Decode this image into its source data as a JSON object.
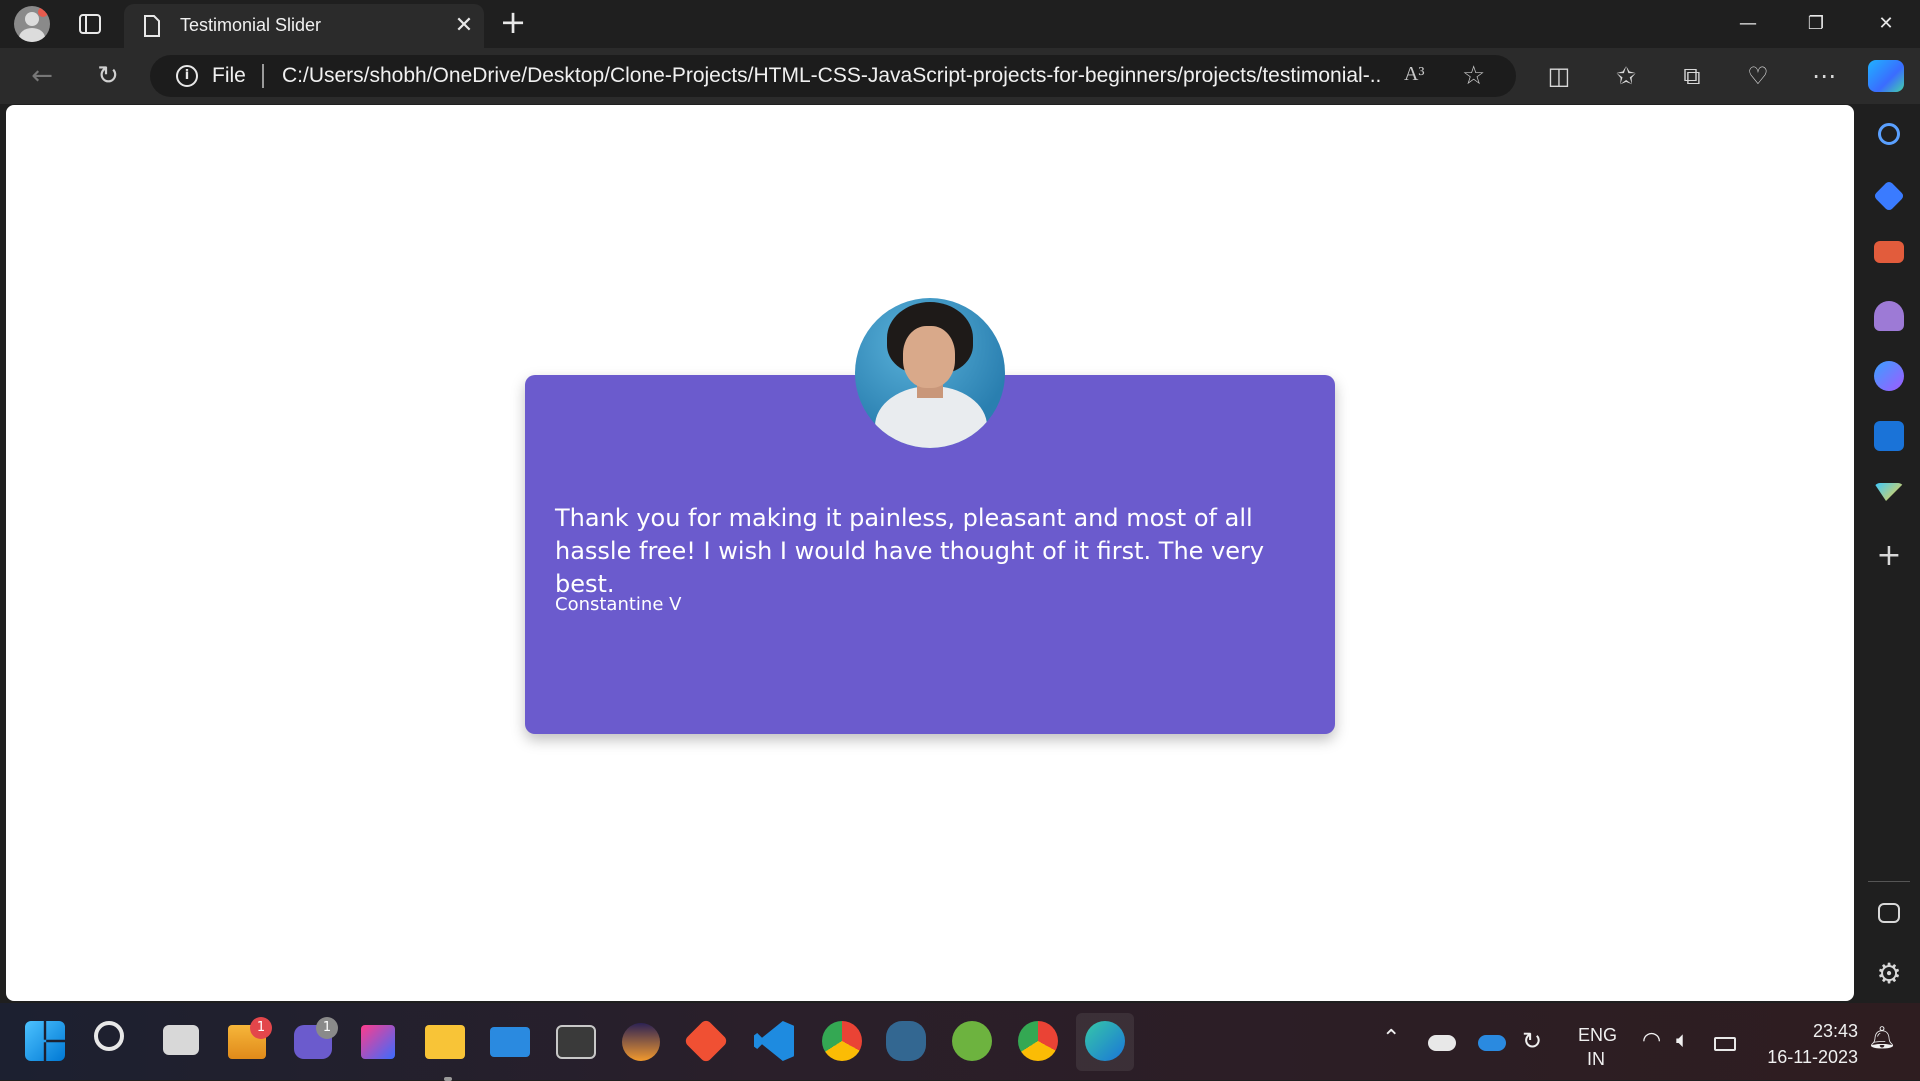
{
  "browser": {
    "tab_title": "Testimonial Slider",
    "new_tab": "+",
    "address_scheme": "File",
    "address_url": "C:/Users/shobh/OneDrive/Desktop/Clone-Projects/HTML-CSS-JavaScript-projects-for-beginners/projects/testimonial-...",
    "read_aloud": "A³",
    "window_controls": [
      "minimize-icon",
      "restore-icon",
      "close-icon"
    ]
  },
  "testimonial": {
    "quote": "Thank you for making it painless, pleasant and most of all hassle free! I wish I would have thought of it first. The very best.",
    "author": "Constantine V"
  },
  "sidebar_icons": [
    "search-icon",
    "tag-icon",
    "toolbox-icon",
    "chess-icon",
    "copilot-icon",
    "outlook-icon",
    "send-icon",
    "add-icon",
    "sidebar-toggle-icon",
    "settings-icon"
  ],
  "taskbar": {
    "apps": [
      "windows-start",
      "search",
      "task-view",
      "widgets",
      "teams-chat",
      "intellij",
      "file-explorer",
      "mail",
      "terminal",
      "eclipse",
      "git",
      "vscode",
      "chrome",
      "postgresql",
      "spring",
      "chrome-dev",
      "edge"
    ],
    "badges": {
      "widgets": "1",
      "teams-chat": "1"
    },
    "language_top": "ENG",
    "language_bottom": "IN",
    "time": "23:43",
    "date": "16-11-2023"
  }
}
